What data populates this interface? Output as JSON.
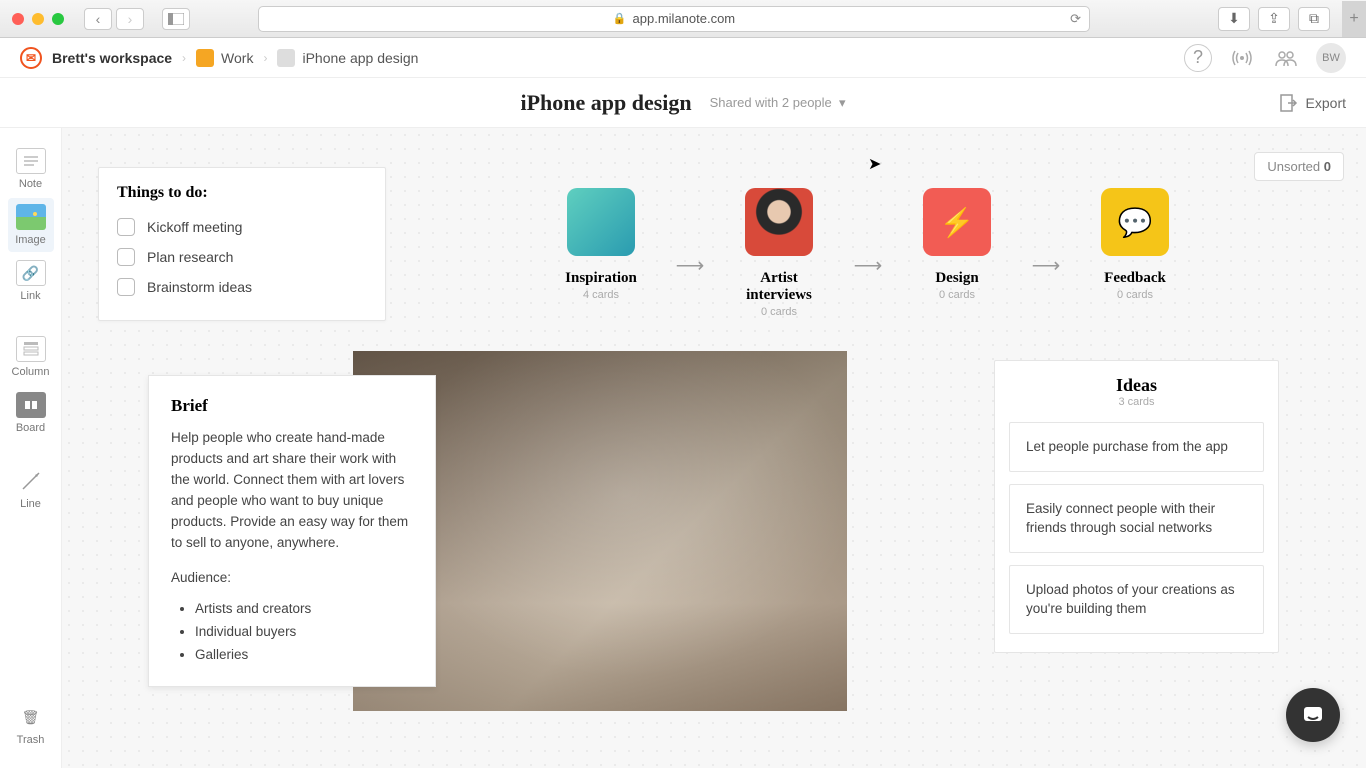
{
  "browser": {
    "url": "app.milanote.com"
  },
  "breadcrumb": {
    "workspace": "Brett's workspace",
    "items": [
      {
        "label": "Work",
        "color": "#f5a623"
      },
      {
        "label": "iPhone app design",
        "color": "#ddd"
      }
    ]
  },
  "header": {
    "avatar_initials": "BW"
  },
  "title": {
    "board_name": "iPhone app design",
    "shared_text": "Shared with 2 people",
    "export_label": "Export"
  },
  "toolbar": {
    "note": "Note",
    "image": "Image",
    "link": "Link",
    "column": "Column",
    "board": "Board",
    "line": "Line",
    "trash": "Trash"
  },
  "todo": {
    "title": "Things to do:",
    "items": [
      "Kickoff meeting",
      "Plan research",
      "Brainstorm ideas"
    ]
  },
  "flow": [
    {
      "name": "Inspiration",
      "sub": "4 cards",
      "bg": "#5fcfbf"
    },
    {
      "name": "Artist interviews",
      "sub": "0 cards",
      "bg": "#b04a3a"
    },
    {
      "name": "Design",
      "sub": "0 cards",
      "bg": "#f25c54"
    },
    {
      "name": "Feedback",
      "sub": "0 cards",
      "bg": "#f5c518"
    }
  ],
  "brief": {
    "title": "Brief",
    "body": "Help people who create hand-made products and art share their work with the world. Connect them with art lovers and people who want to buy unique products. Provide an easy way for them to sell to anyone, anywhere.",
    "audience_label": "Audience:",
    "audience": [
      "Artists and creators",
      "Individual buyers",
      "Galleries"
    ]
  },
  "ideas": {
    "title": "Ideas",
    "sub": "3 cards",
    "items": [
      "Let people purchase from the app",
      "Easily connect people with their friends through social networks",
      "Upload photos of your creations as you're building them"
    ]
  },
  "unsorted": {
    "label": "Unsorted",
    "count": "0"
  }
}
